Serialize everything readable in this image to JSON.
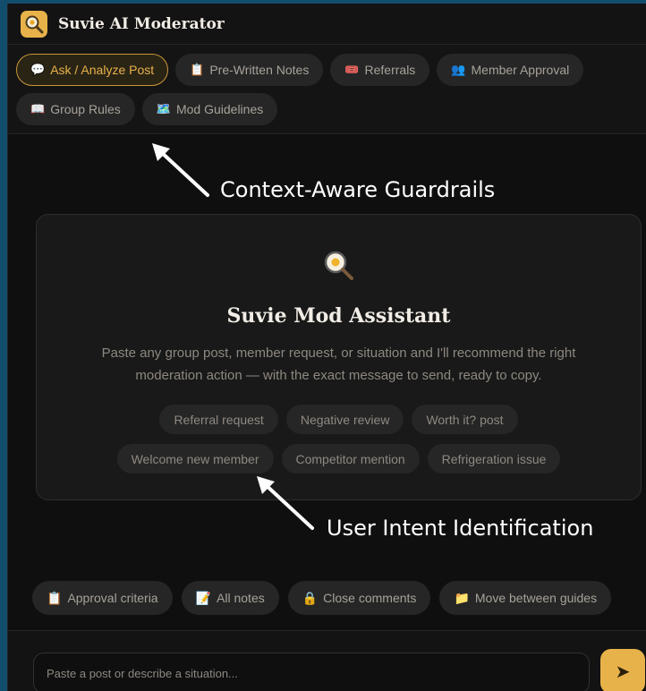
{
  "header": {
    "title": "Suvie AI Moderator",
    "logo_icon": "magnifier-egg-icon",
    "accent": "#e8b24a"
  },
  "tabs": [
    {
      "icon": "💬",
      "label": "Ask / Analyze Post",
      "active": true
    },
    {
      "icon": "📋",
      "label": "Pre-Written Notes"
    },
    {
      "icon": "🎟️",
      "label": "Referrals"
    },
    {
      "icon": "👥",
      "label": "Member Approval"
    },
    {
      "icon": "📖",
      "label": "Group Rules"
    },
    {
      "icon": "🗺️",
      "label": "Mod Guidelines"
    }
  ],
  "annotations": {
    "guardrails": "Context-Aware Guardrails",
    "intent": "User Intent Identification"
  },
  "assistant": {
    "title": "Suvie Mod Assistant",
    "description": "Paste any group post, member request, or situation and I'll recommend the right moderation action — with the exact message to send, ready to copy.",
    "suggestions_row1": [
      "Referral request",
      "Negative review",
      "Worth it? post"
    ],
    "suggestions_row2": [
      "Welcome new member",
      "Competitor mention",
      "Refrigeration issue"
    ]
  },
  "quick_actions": [
    {
      "icon": "📋",
      "label": "Approval criteria"
    },
    {
      "icon": "📝",
      "label": "All notes"
    },
    {
      "icon": "🔒",
      "label": "Close comments"
    },
    {
      "icon": "📁",
      "label": "Move between guides"
    }
  ],
  "input": {
    "placeholder": "Paste a post or describe a situation...",
    "send_icon": "➤"
  }
}
